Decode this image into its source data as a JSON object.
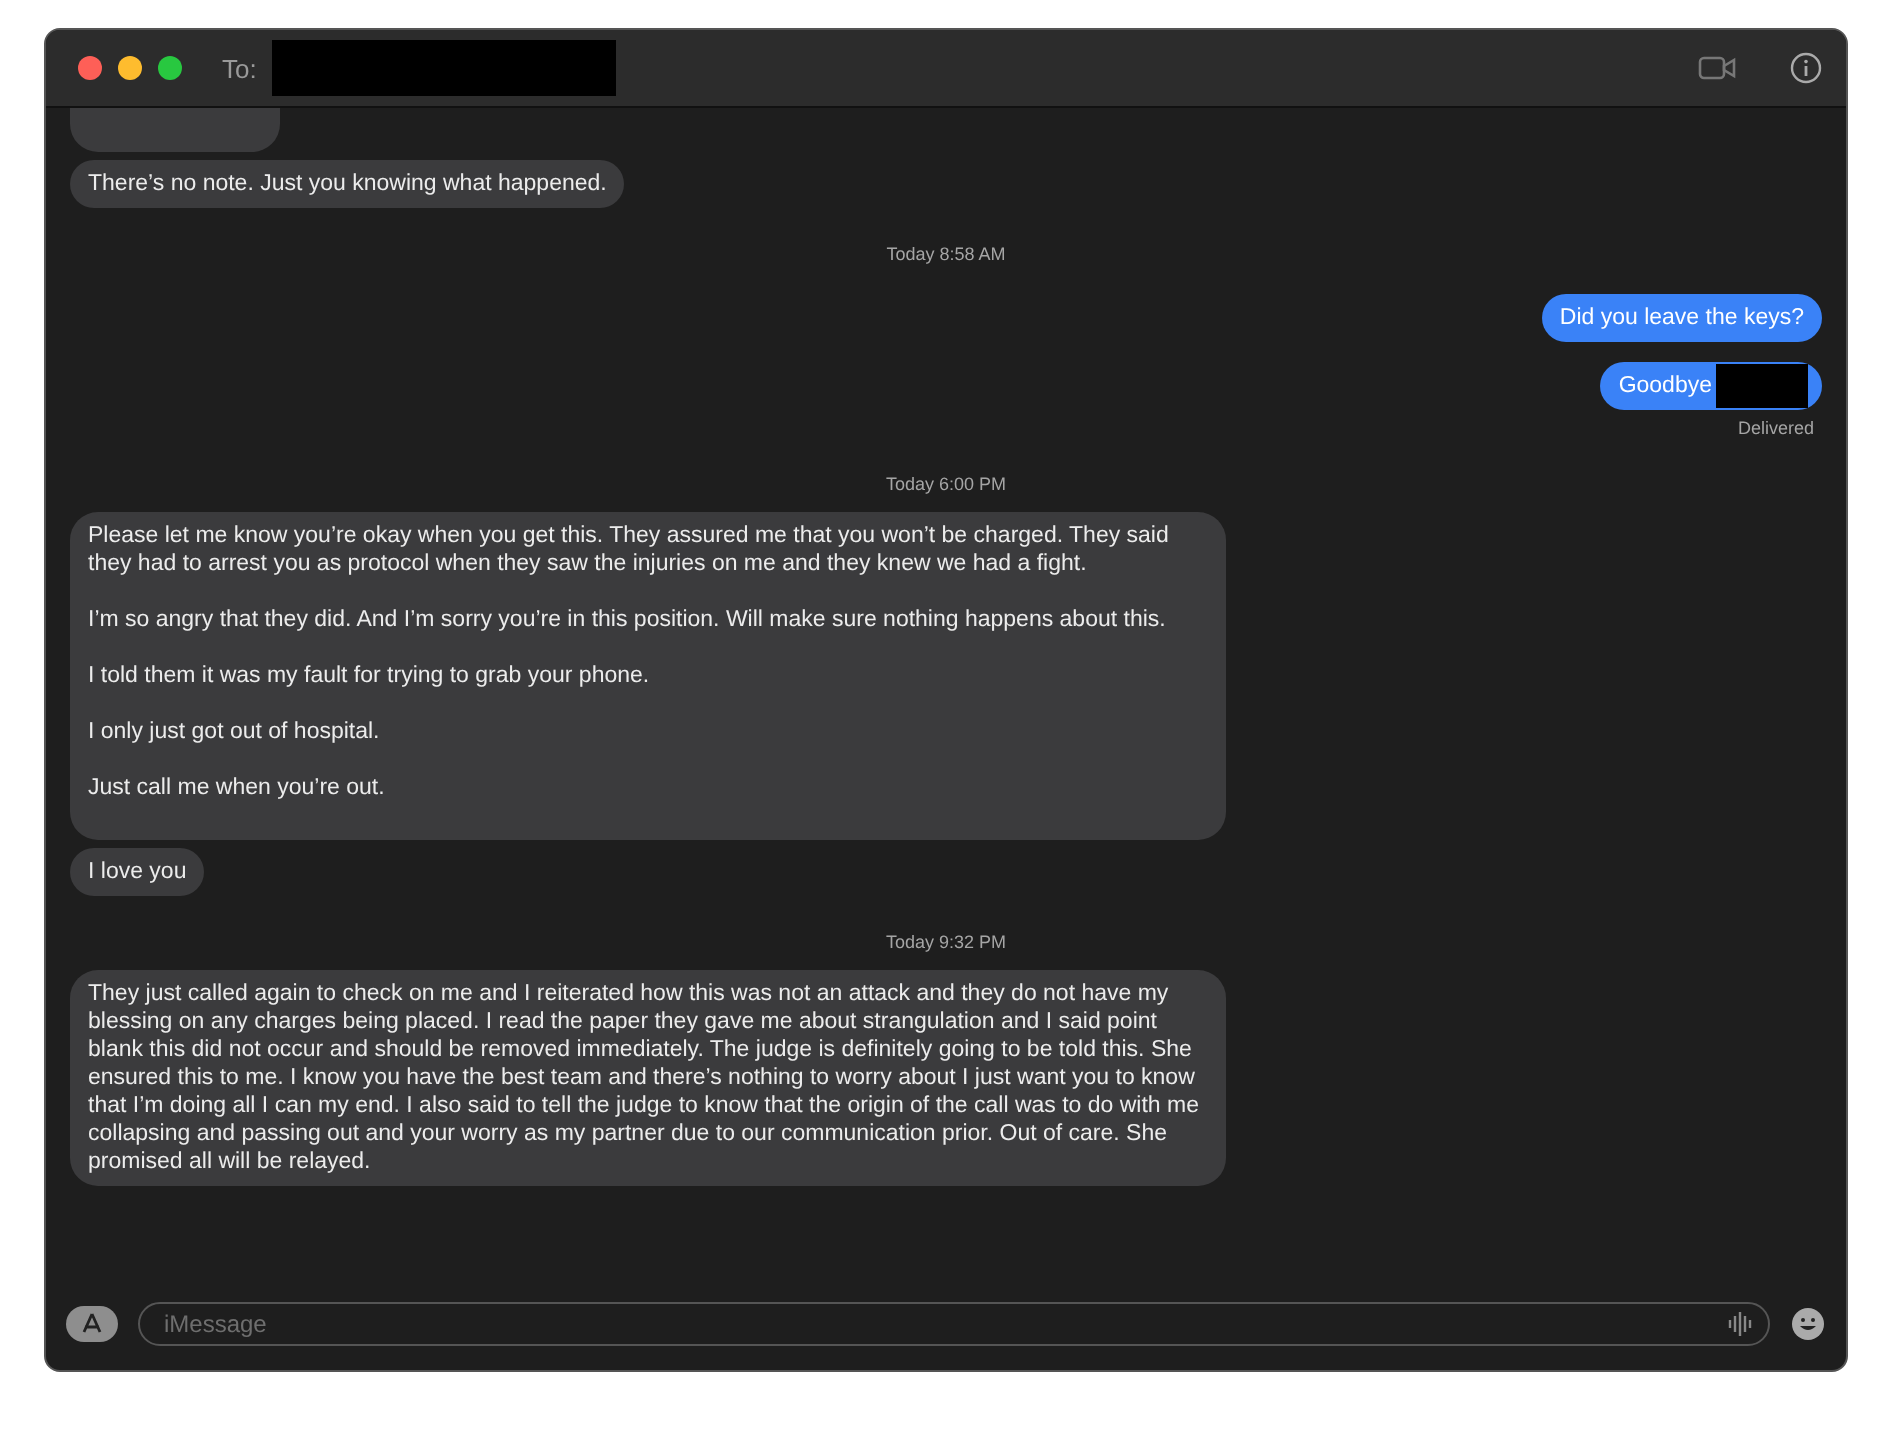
{
  "window": {
    "recipient_label": "To:",
    "recipient_redacted": true
  },
  "messages": [
    {
      "kind": "cut"
    },
    {
      "kind": "received",
      "text": "There’s no note. Just you knowing what happened.",
      "redacted": false
    },
    {
      "kind": "timestamp",
      "text": "Today 8:58 AM"
    },
    {
      "kind": "sent",
      "text": "Did you leave the keys?",
      "redacted": false
    },
    {
      "kind": "sent",
      "text": "Goodbye",
      "redacted": true
    },
    {
      "kind": "status",
      "text": "Delivered"
    },
    {
      "kind": "timestamp",
      "text": "Today 6:00 PM"
    },
    {
      "kind": "received",
      "text": "Please let me know you’re okay when you get this. They assured me that you won’t be charged. They said they had to arrest you as protocol when they saw the injuries on me and they knew we had a fight.\n\nI’m so angry that they did. And I’m sorry you’re in this position. Will make sure nothing happens about this.\n\nI told them it was my fault for trying to grab your phone.\n\nI only just got out of hospital.\n\nJust call me when you’re out.\n\n",
      "redacted": false
    },
    {
      "kind": "received",
      "text": "I love you",
      "redacted": false
    },
    {
      "kind": "timestamp",
      "text": "Today 9:32 PM"
    },
    {
      "kind": "received",
      "text": "They just called again to check on me and I reiterated how this was not an attack and they do not have my blessing on any charges being placed. I read the paper they gave me about strangulation and I said point blank this did not occur and should be removed immediately. The judge is definitely going to be told this. She ensured this to me. I know you have the best team and there’s nothing to worry about I just want you to know that I’m doing all I can my end. I also said to tell the judge to know that the origin of the call was to do with me collapsing and passing out and your worry as my partner due to our communication prior. Out of care. She promised all will be relayed.",
      "redacted": false
    }
  ],
  "composer": {
    "placeholder": "iMessage"
  }
}
